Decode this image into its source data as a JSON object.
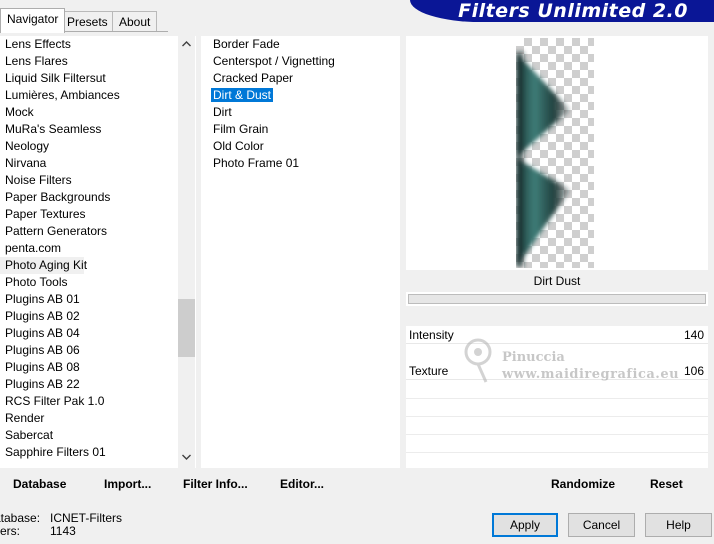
{
  "tabs": [
    "Navigator",
    "Presets",
    "About"
  ],
  "banner_title": "Filters Unlimited 2.0",
  "categories": [
    "Lens Effects",
    "Lens Flares",
    "Liquid Silk Filtersut",
    "Lumières, Ambiances",
    "Mock",
    "MuRa's Seamless",
    "Neology",
    "Nirvana",
    "Noise Filters",
    "Paper Backgrounds",
    "Paper Textures",
    "Pattern Generators",
    "penta.com",
    "Photo Aging Kit",
    "Photo Tools",
    "Plugins AB 01",
    "Plugins AB 02",
    "Plugins AB 04",
    "Plugins AB 06",
    "Plugins AB 08",
    "Plugins AB 22",
    "RCS Filter Pak 1.0",
    "Render",
    "Sabercat",
    "Sapphire Filters 01"
  ],
  "highlighted_category": "Photo Aging Kit",
  "filters": [
    "Border Fade",
    "Centerspot / Vignetting",
    "Cracked Paper",
    "Dirt & Dust",
    "Dirt",
    "Film Grain",
    "Old Color",
    "Photo Frame 01"
  ],
  "selected_filter": "Dirt & Dust",
  "selected_filter_display": "Dirt  Dust",
  "params": [
    {
      "label": "Intensity",
      "value": "140"
    },
    {
      "label": "Texture",
      "value": "106"
    }
  ],
  "watermark": {
    "line1": "Pinuccia",
    "line2": "www.maidiregrafica.eu"
  },
  "actions": {
    "database": "Database",
    "import": "Import...",
    "filter_info": "Filter Info...",
    "editor": "Editor..."
  },
  "right_actions": {
    "randomize": "Randomize",
    "reset": "Reset"
  },
  "info": {
    "database_label": "atabase:",
    "database_value": "ICNET-Filters",
    "filters_label": "lters:",
    "filters_value": "1143"
  },
  "buttons": {
    "apply": "Apply",
    "cancel": "Cancel",
    "help": "Help"
  },
  "colors": {
    "banner": "#0a1696",
    "selection": "#0078d7"
  },
  "icons": {
    "scroll_up": "chevron-up-icon",
    "scroll_down": "chevron-down-icon"
  }
}
